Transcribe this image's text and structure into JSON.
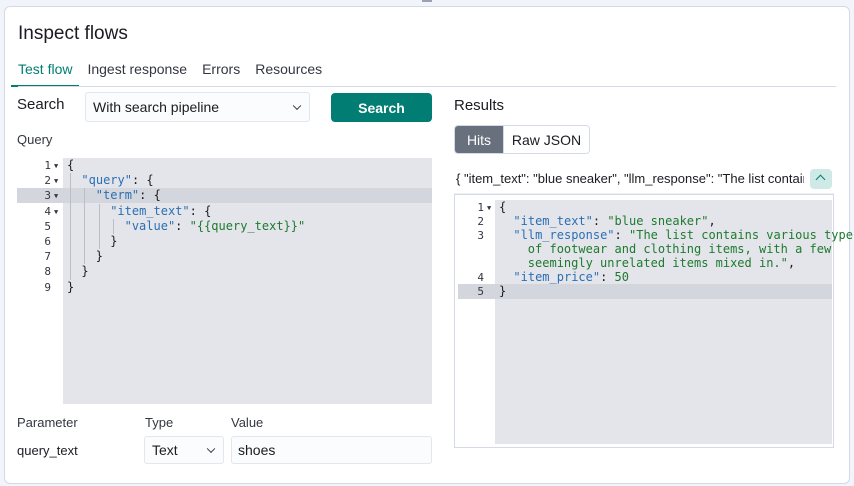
{
  "title": "Inspect flows",
  "tabs": [
    {
      "label": "Test flow",
      "active": true
    },
    {
      "label": "Ingest response",
      "active": false
    },
    {
      "label": "Errors",
      "active": false
    },
    {
      "label": "Resources",
      "active": false
    }
  ],
  "search": {
    "label": "Search",
    "pipeline_select": "With search pipeline",
    "button": "Search"
  },
  "query": {
    "label": "Query",
    "lines": [
      {
        "num": "1",
        "fold": true,
        "indent": 0,
        "tokens": [
          {
            "t": "{",
            "c": "p"
          }
        ]
      },
      {
        "num": "2",
        "fold": true,
        "indent": 1,
        "tokens": [
          {
            "t": "\"query\"",
            "c": "k"
          },
          {
            "t": ": {",
            "c": "p"
          }
        ]
      },
      {
        "num": "3",
        "fold": true,
        "indent": 2,
        "tokens": [
          {
            "t": "\"term\"",
            "c": "k"
          },
          {
            "t": ": {",
            "c": "p"
          }
        ]
      },
      {
        "num": "4",
        "fold": true,
        "indent": 3,
        "tokens": [
          {
            "t": "\"item_text\"",
            "c": "k"
          },
          {
            "t": ": {",
            "c": "p"
          }
        ]
      },
      {
        "num": "5",
        "fold": false,
        "indent": 4,
        "tokens": [
          {
            "t": "\"value\"",
            "c": "k"
          },
          {
            "t": ": ",
            "c": "p"
          },
          {
            "t": "\"{{query_text}}\"",
            "c": "s"
          }
        ]
      },
      {
        "num": "6",
        "fold": false,
        "indent": 3,
        "tokens": [
          {
            "t": "}",
            "c": "p"
          }
        ]
      },
      {
        "num": "7",
        "fold": false,
        "indent": 2,
        "tokens": [
          {
            "t": "}",
            "c": "p"
          }
        ]
      },
      {
        "num": "8",
        "fold": false,
        "indent": 1,
        "tokens": [
          {
            "t": "}",
            "c": "p"
          }
        ]
      },
      {
        "num": "9",
        "fold": false,
        "indent": 0,
        "tokens": [
          {
            "t": "}",
            "c": "p"
          }
        ]
      }
    ]
  },
  "params": {
    "headers": {
      "parameter": "Parameter",
      "type": "Type",
      "value": "Value"
    },
    "rows": [
      {
        "name": "query_text",
        "type": "Text",
        "value": "shoes"
      }
    ]
  },
  "results": {
    "label": "Results",
    "toggle": {
      "hits": "Hits",
      "raw": "Raw JSON",
      "selected": "hits"
    },
    "summary": "{ \"item_text\": \"blue sneaker\", \"llm_response\": \"The list contains various types of footwear and clothing items, with a few seemingly unrelated items mixed in.\", \"item_price\": 50 }",
    "lines": [
      {
        "num": "1",
        "fold": true,
        "indent": 0,
        "tokens": [
          {
            "t": "{",
            "c": "p"
          }
        ]
      },
      {
        "num": "2",
        "fold": false,
        "indent": 1,
        "tokens": [
          {
            "t": "\"item_text\"",
            "c": "k"
          },
          {
            "t": ": ",
            "c": "p"
          },
          {
            "t": "\"blue sneaker\"",
            "c": "s"
          },
          {
            "t": ",",
            "c": "p"
          }
        ]
      },
      {
        "num": "3",
        "fold": false,
        "indent": 1,
        "tokens": [
          {
            "t": "\"llm_response\"",
            "c": "k"
          },
          {
            "t": ": ",
            "c": "p"
          },
          {
            "t": "\"The list contains various types",
            "c": "s"
          }
        ]
      },
      {
        "num": "",
        "fold": false,
        "indent": 2,
        "tokens": [
          {
            "t": "of footwear and clothing items, with a few",
            "c": "s"
          }
        ]
      },
      {
        "num": "",
        "fold": false,
        "indent": 2,
        "tokens": [
          {
            "t": "seemingly unrelated items mixed in.\"",
            "c": "s"
          },
          {
            "t": ",",
            "c": "p"
          }
        ]
      },
      {
        "num": "4",
        "fold": false,
        "indent": 1,
        "tokens": [
          {
            "t": "\"item_price\"",
            "c": "k"
          },
          {
            "t": ": ",
            "c": "p"
          },
          {
            "t": "50",
            "c": "n"
          }
        ]
      },
      {
        "num": "5",
        "fold": false,
        "indent": 0,
        "tokens": [
          {
            "t": "}",
            "c": "p"
          }
        ]
      }
    ]
  }
}
